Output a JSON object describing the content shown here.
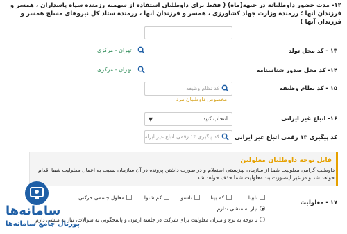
{
  "intro": {
    "text": "۱۲- مدت حضور داوطلبانه در جبهه(ماه) ( فقط برای داوطلبان استفاده از سهمیه رزمنده سپاه پاسداران ، همسر و فرزندان آنها ؛ رزمنده وزارت جهاد کشاورزی ، همسر و فرزندان آنها ، رزمنده ستاد کل نیروهای مسلح همسر و فرزندان آنها )"
  },
  "fields": {
    "birth_place": {
      "label": "۱۳ - کد محل تولد",
      "value": "تهران - مرکزی"
    },
    "issue_place": {
      "label": "۱۴- کد محل صدور شناسنامه",
      "value": "تهران - مرکزی"
    },
    "duty": {
      "label": "۱۵ - کد نظام وظیفه",
      "placeholder": "کد نظام وظیفه",
      "hint": "مخصوص داوطلبان مرد"
    },
    "nationality": {
      "label": "۱۶- اتباع غیر ایرانی",
      "selected": "انتخاب کنید"
    },
    "tracking": {
      "label": "کد پیگیری ۱۳ رقمی اتباع غیر ایرانی",
      "placeholder": "کد پیگیری ۱۳ رقمی اتباع غیر ایرانی"
    }
  },
  "notice": {
    "title": "قابل توجه داوطلبان معلولین",
    "text": "داوطلب گرامی معلولیت شما از سازمان بهزیستی استعلام و در صورت داشتن پرونده در آن سازمان نسبت به اعمال معلولیت شما اقدام خواهد شد و در غیر اینصورت بند معلولیت شما حذف خواهد شد"
  },
  "disability": {
    "label": "۱۷ - معلولیت",
    "options": [
      "نابینا",
      "کم بینا",
      "ناشنوا",
      "کم شنوا",
      "معلول جسمی حرکتی"
    ],
    "radio1": "نیاز به منشی ندارم",
    "radio2": "با توجه به نوع و میزان معلولیت برای شرکت در جلسه آزمون و پاسخگویی به سوالات، نیاز به منشی دارم"
  },
  "logo": {
    "line1": "سامانه‌ها",
    "line2": "پورتال جامع سامانه‌ها"
  },
  "colors": {
    "accent": "#e6a100",
    "picked": "#2e8b57",
    "brand": "#1f5fa6"
  }
}
